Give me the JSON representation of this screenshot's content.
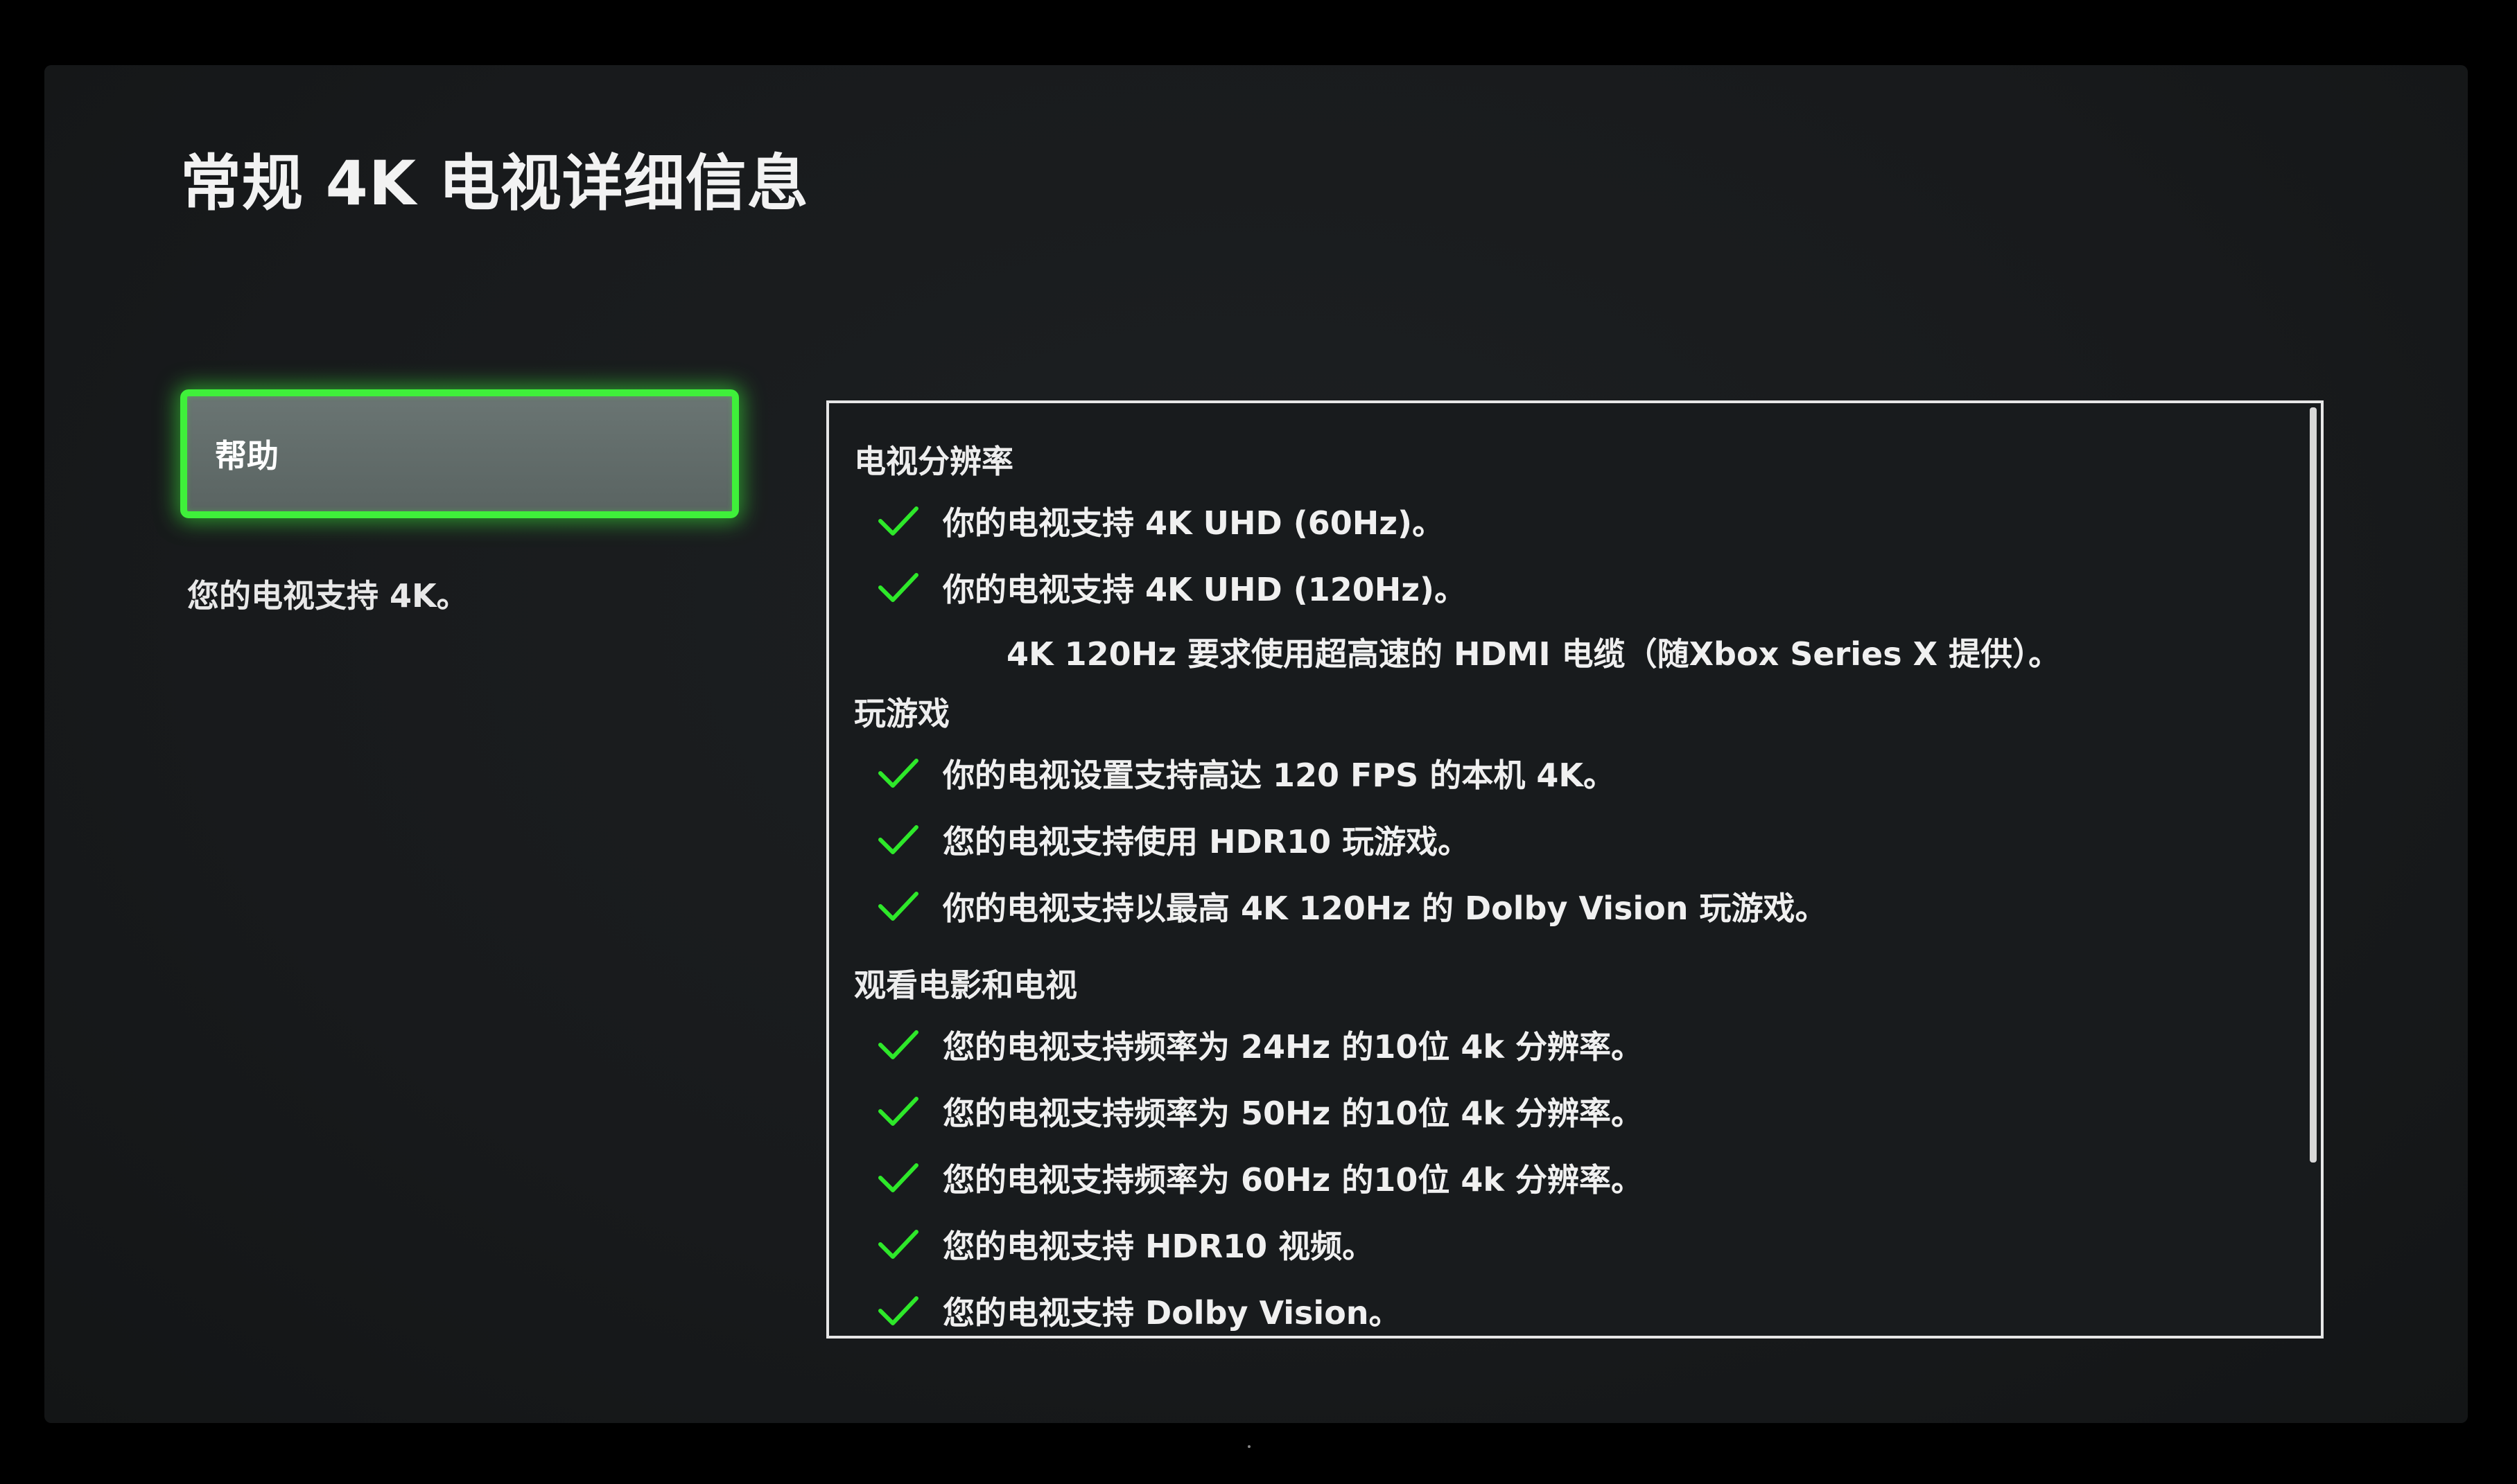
{
  "page": {
    "title": "常规 4K 电视详细信息"
  },
  "sidebar": {
    "help_label": "帮助",
    "status_text": "您的电视支持 4K。"
  },
  "details": {
    "tv_resolution": {
      "title": "电视分辨率",
      "items": [
        "你的电视支持 4K UHD (60Hz)。",
        "你的电视支持 4K UHD (120Hz)。"
      ],
      "note": "4K 120Hz 要求使用超高速的 HDMI 电缆（随Xbox Series X 提供）。"
    },
    "gaming": {
      "title": "玩游戏",
      "items": [
        "你的电视设置支持高达 120 FPS 的本机 4K。",
        "您的电视支持使用 HDR10 玩游戏。",
        "你的电视支持以最高 4K 120Hz 的 Dolby Vision 玩游戏。"
      ]
    },
    "movies_tv": {
      "title": "观看电影和电视",
      "items": [
        "您的电视支持频率为 24Hz 的10位 4k 分辨率。",
        "您的电视支持频率为 50Hz 的10位 4k 分辨率。",
        "您的电视支持频率为 60Hz 的10位 4k 分辨率。",
        "您的电视支持 HDR10 视频。",
        "您的电视支持 Dolby Vision。"
      ]
    }
  },
  "icons": {
    "check": "check-icon"
  },
  "colors": {
    "accent_green": "#3ff03a",
    "check_green": "#2ee82a",
    "background": "#181a1c",
    "text": "#f0f0f0"
  }
}
